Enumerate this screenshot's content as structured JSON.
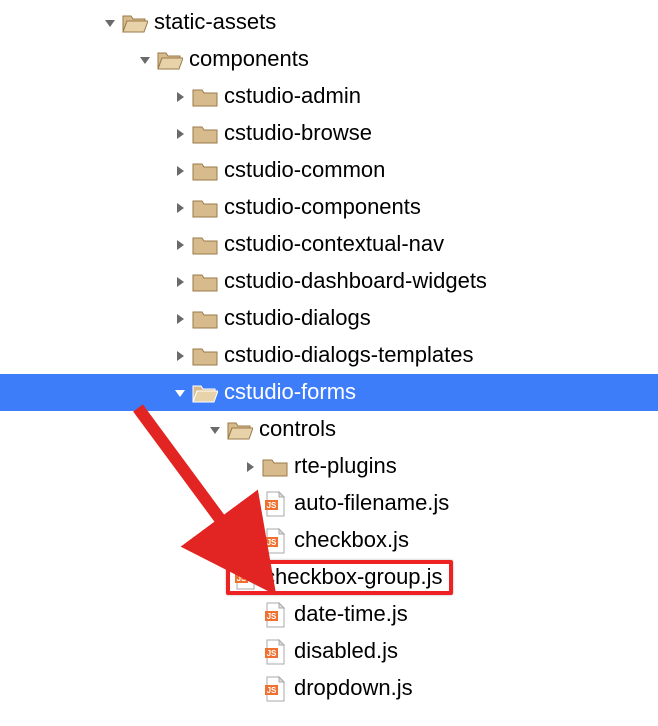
{
  "tree": {
    "items": [
      {
        "depth": 0,
        "disclosure": "down",
        "icon": "folder-open-icon",
        "label": "static-assets",
        "selected": false,
        "highlight": false
      },
      {
        "depth": 1,
        "disclosure": "down",
        "icon": "folder-open-icon",
        "label": "components",
        "selected": false,
        "highlight": false
      },
      {
        "depth": 2,
        "disclosure": "right",
        "icon": "folder-icon",
        "label": "cstudio-admin",
        "selected": false,
        "highlight": false
      },
      {
        "depth": 2,
        "disclosure": "right",
        "icon": "folder-icon",
        "label": "cstudio-browse",
        "selected": false,
        "highlight": false
      },
      {
        "depth": 2,
        "disclosure": "right",
        "icon": "folder-icon",
        "label": "cstudio-common",
        "selected": false,
        "highlight": false
      },
      {
        "depth": 2,
        "disclosure": "right",
        "icon": "folder-icon",
        "label": "cstudio-components",
        "selected": false,
        "highlight": false
      },
      {
        "depth": 2,
        "disclosure": "right",
        "icon": "folder-icon",
        "label": "cstudio-contextual-nav",
        "selected": false,
        "highlight": false
      },
      {
        "depth": 2,
        "disclosure": "right",
        "icon": "folder-icon",
        "label": "cstudio-dashboard-widgets",
        "selected": false,
        "highlight": false
      },
      {
        "depth": 2,
        "disclosure": "right",
        "icon": "folder-icon",
        "label": "cstudio-dialogs",
        "selected": false,
        "highlight": false
      },
      {
        "depth": 2,
        "disclosure": "right",
        "icon": "folder-icon",
        "label": "cstudio-dialogs-templates",
        "selected": false,
        "highlight": false
      },
      {
        "depth": 2,
        "disclosure": "down-white",
        "icon": "folder-open-selected-icon",
        "label": "cstudio-forms",
        "selected": true,
        "highlight": false
      },
      {
        "depth": 3,
        "disclosure": "down",
        "icon": "folder-open-icon",
        "label": "controls",
        "selected": false,
        "highlight": false
      },
      {
        "depth": 4,
        "disclosure": "right",
        "icon": "folder-icon",
        "label": "rte-plugins",
        "selected": false,
        "highlight": false
      },
      {
        "depth": 4,
        "disclosure": "none",
        "icon": "js-file-icon",
        "label": "auto-filename.js",
        "selected": false,
        "highlight": false
      },
      {
        "depth": 4,
        "disclosure": "none",
        "icon": "js-file-icon",
        "label": "checkbox.js",
        "selected": false,
        "highlight": false
      },
      {
        "depth": 4,
        "disclosure": "none",
        "icon": "js-file-icon",
        "label": "checkbox-group.js",
        "selected": false,
        "highlight": true
      },
      {
        "depth": 4,
        "disclosure": "none",
        "icon": "js-file-icon",
        "label": "date-time.js",
        "selected": false,
        "highlight": false
      },
      {
        "depth": 4,
        "disclosure": "none",
        "icon": "js-file-icon",
        "label": "disabled.js",
        "selected": false,
        "highlight": false
      },
      {
        "depth": 4,
        "disclosure": "none",
        "icon": "js-file-icon",
        "label": "dropdown.js",
        "selected": false,
        "highlight": false
      }
    ]
  },
  "annotations": {
    "highlight_color": "#e22422",
    "arrow_color": "#e22422"
  }
}
